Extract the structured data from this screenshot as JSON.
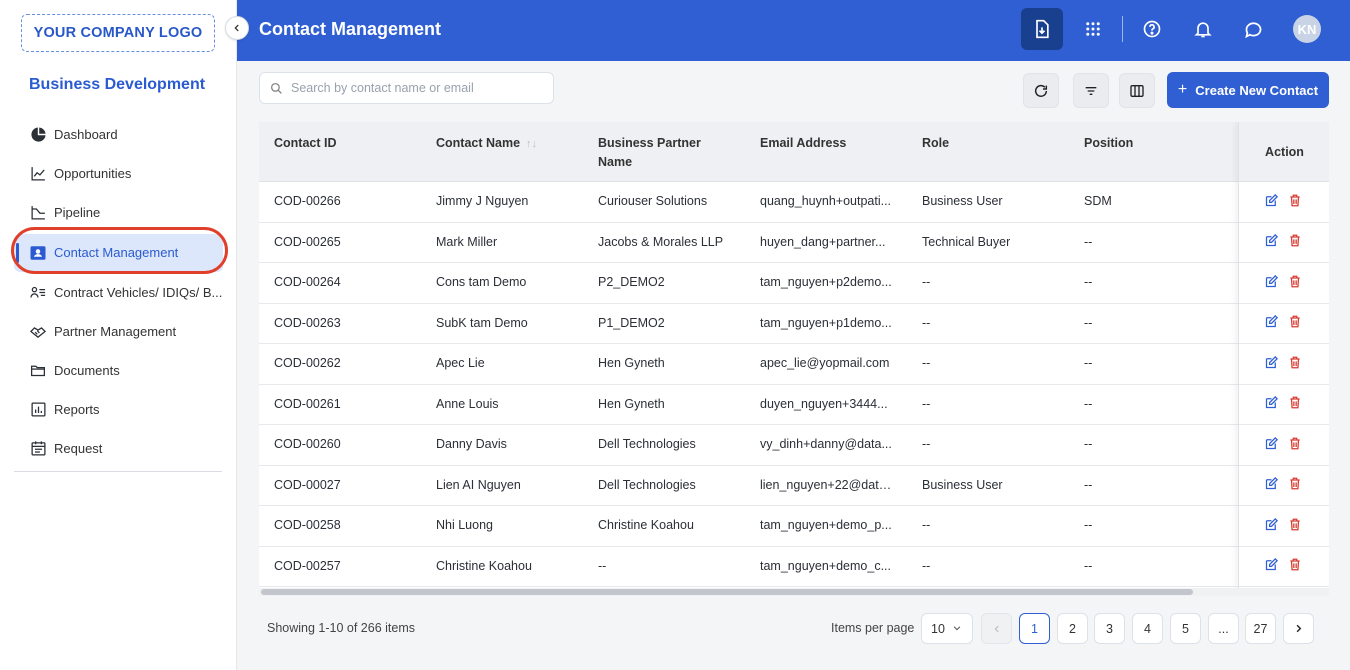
{
  "sidebar": {
    "logo": "YOUR COMPANY LOGO",
    "section_title": "Business Development",
    "items": [
      {
        "label": "Dashboard",
        "icon": "pie-chart-icon"
      },
      {
        "label": "Opportunities",
        "icon": "line-chart-icon"
      },
      {
        "label": "Pipeline",
        "icon": "pipeline-icon"
      },
      {
        "label": "Contact Management",
        "icon": "contact-card-icon",
        "active": true
      },
      {
        "label": "Contract Vehicles/ IDIQs/ B...",
        "icon": "people-list-icon"
      },
      {
        "label": "Partner Management",
        "icon": "handshake-icon"
      },
      {
        "label": "Documents",
        "icon": "folder-icon"
      },
      {
        "label": "Reports",
        "icon": "report-icon"
      },
      {
        "label": "Request",
        "icon": "calendar-list-icon"
      }
    ]
  },
  "header": {
    "title": "Contact Management",
    "avatar_initials": "KN"
  },
  "toolbar": {
    "search_placeholder": "Search by contact name or email",
    "create_label": "Create New Contact"
  },
  "table": {
    "columns": [
      "Contact ID",
      "Contact Name",
      "Business Partner Name",
      "Email Address",
      "Role",
      "Position"
    ],
    "action_header": "Action",
    "rows": [
      [
        "COD-00266",
        "Jimmy J Nguyen",
        "Curiouser Solutions",
        "quang_huynh+outpati...",
        "Business User",
        "SDM"
      ],
      [
        "COD-00265",
        "Mark Miller",
        "Jacobs & Morales LLP",
        "huyen_dang+partner...",
        "Technical Buyer",
        "--"
      ],
      [
        "COD-00264",
        "Cons tam Demo",
        "P2_DEMO2",
        "tam_nguyen+p2demo...",
        "--",
        "--"
      ],
      [
        "COD-00263",
        "SubK tam Demo",
        "P1_DEMO2",
        "tam_nguyen+p1demo...",
        "--",
        "--"
      ],
      [
        "COD-00262",
        "Apec Lie",
        "Hen Gyneth",
        "apec_lie@yopmail.com",
        "--",
        "--"
      ],
      [
        "COD-00261",
        "Anne Louis",
        "Hen Gyneth",
        "duyen_nguyen+3444...",
        "--",
        "--"
      ],
      [
        "COD-00260",
        "Danny Davis",
        "Dell Technologies",
        "vy_dinh+danny@data...",
        "--",
        "--"
      ],
      [
        "COD-00027",
        "Lien AI Nguyen",
        "Dell Technologies",
        "lien_nguyen+22@data...",
        "Business User",
        "--"
      ],
      [
        "COD-00258",
        "Nhi Luong",
        "Christine Koahou",
        "tam_nguyen+demo_p...",
        "--",
        "--"
      ],
      [
        "COD-00257",
        "Christine Koahou",
        "--",
        "tam_nguyen+demo_c...",
        "--",
        "--"
      ]
    ]
  },
  "footer": {
    "showing": "Showing 1-10 of 266 items",
    "items_per_page_label": "Items per page",
    "items_per_page_value": "10",
    "pages": [
      "1",
      "2",
      "3",
      "4",
      "5",
      "...",
      "27"
    ],
    "current_page": "1"
  },
  "colors": {
    "primary": "#2f5fd2",
    "highlight_ring": "#e0402b",
    "delete": "#d93a32"
  }
}
